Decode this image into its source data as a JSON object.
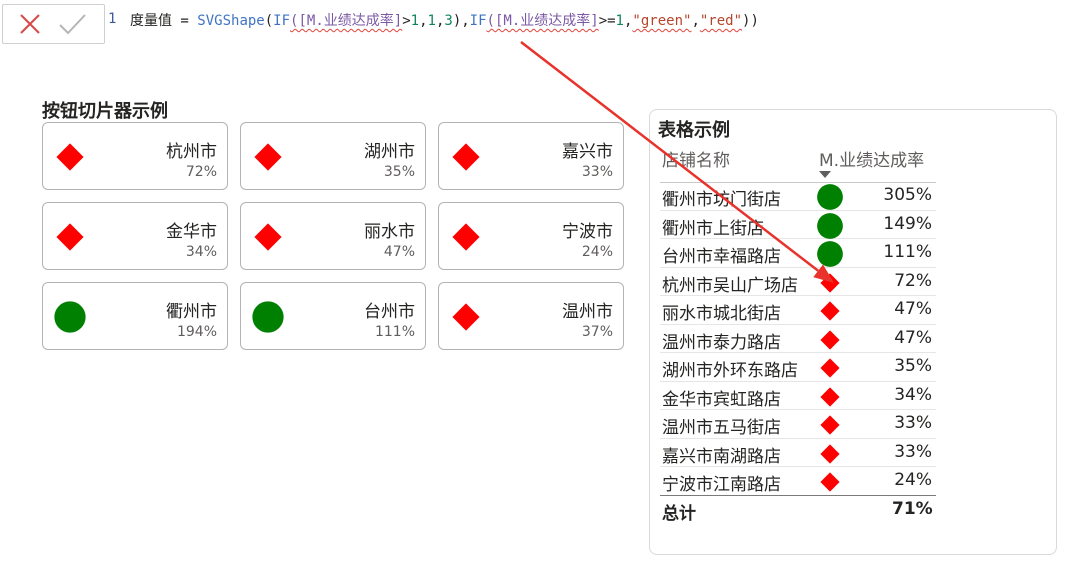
{
  "formula_bar": {
    "line_number": "1",
    "tokens": [
      {
        "text": "度量值 = ",
        "cls": ""
      },
      {
        "text": "SVGShape",
        "cls": "tk-fn"
      },
      {
        "text": "(",
        "cls": ""
      },
      {
        "text": "IF",
        "cls": "tk-fn"
      },
      {
        "text": "([M.业绩达成率]",
        "cls": "tk-col"
      },
      {
        "text": ">",
        "cls": ""
      },
      {
        "text": "1",
        "cls": "tk-num"
      },
      {
        "text": ",",
        "cls": ""
      },
      {
        "text": "1",
        "cls": "tk-num"
      },
      {
        "text": ",",
        "cls": ""
      },
      {
        "text": "3",
        "cls": "tk-num"
      },
      {
        "text": "),",
        "cls": ""
      },
      {
        "text": "IF",
        "cls": "tk-fn"
      },
      {
        "text": "([M.业绩达成率]",
        "cls": "tk-col"
      },
      {
        "text": ">=",
        "cls": ""
      },
      {
        "text": "1",
        "cls": "tk-num"
      },
      {
        "text": ",",
        "cls": ""
      },
      {
        "text": "\"green\"",
        "cls": "tk-str"
      },
      {
        "text": ",",
        "cls": ""
      },
      {
        "text": "\"red\"",
        "cls": "tk-str"
      },
      {
        "text": "))",
        "cls": ""
      }
    ],
    "cancel_icon": "x-icon",
    "commit_icon": "check-icon"
  },
  "slicer": {
    "title": "按钮切片器示例",
    "tiles": [
      {
        "city": "杭州市",
        "pct": "72%",
        "shape": "diamond",
        "color": "#ff0000"
      },
      {
        "city": "湖州市",
        "pct": "35%",
        "shape": "diamond",
        "color": "#ff0000"
      },
      {
        "city": "嘉兴市",
        "pct": "33%",
        "shape": "diamond",
        "color": "#ff0000"
      },
      {
        "city": "金华市",
        "pct": "34%",
        "shape": "diamond",
        "color": "#ff0000"
      },
      {
        "city": "丽水市",
        "pct": "47%",
        "shape": "diamond",
        "color": "#ff0000"
      },
      {
        "city": "宁波市",
        "pct": "24%",
        "shape": "diamond",
        "color": "#ff0000"
      },
      {
        "city": "衢州市",
        "pct": "194%",
        "shape": "circle",
        "color": "#008000"
      },
      {
        "city": "台州市",
        "pct": "111%",
        "shape": "circle",
        "color": "#008000"
      },
      {
        "city": "温州市",
        "pct": "37%",
        "shape": "diamond",
        "color": "#ff0000"
      }
    ]
  },
  "table": {
    "title": "表格示例",
    "col_store": "店铺名称",
    "col_rate": "M.业绩达成率",
    "rows": [
      {
        "store": "衢州市坊门街店",
        "val": "305%",
        "shape": "circle",
        "color": "#008000"
      },
      {
        "store": "衢州市上街店",
        "val": "149%",
        "shape": "circle",
        "color": "#008000"
      },
      {
        "store": "台州市幸福路店",
        "val": "111%",
        "shape": "circle",
        "color": "#008000"
      },
      {
        "store": "杭州市吴山广场店",
        "val": "72%",
        "shape": "diamond",
        "color": "#ff0000"
      },
      {
        "store": "丽水市城北街店",
        "val": "47%",
        "shape": "diamond",
        "color": "#ff0000"
      },
      {
        "store": "温州市泰力路店",
        "val": "47%",
        "shape": "diamond",
        "color": "#ff0000"
      },
      {
        "store": "湖州市外环东路店",
        "val": "35%",
        "shape": "diamond",
        "color": "#ff0000"
      },
      {
        "store": "金华市宾虹路店",
        "val": "34%",
        "shape": "diamond",
        "color": "#ff0000"
      },
      {
        "store": "温州市五马街店",
        "val": "33%",
        "shape": "diamond",
        "color": "#ff0000"
      },
      {
        "store": "嘉兴市南湖路店",
        "val": "33%",
        "shape": "diamond",
        "color": "#ff0000"
      },
      {
        "store": "宁波市江南路店",
        "val": "24%",
        "shape": "diamond",
        "color": "#ff0000"
      }
    ],
    "total_label": "总计",
    "total_val": "71%"
  },
  "colors": {
    "accent_arrow": "#e8322b",
    "good": "#008000",
    "bad": "#ff0000"
  }
}
